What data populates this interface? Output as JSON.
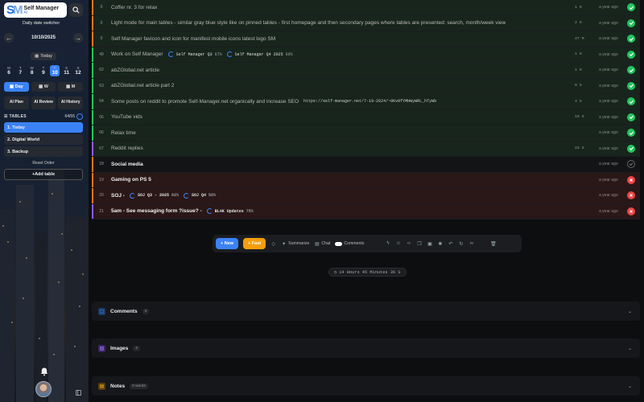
{
  "app": {
    "title": "Self Manager",
    "subtitle": "AI",
    "daily_switcher": "Daily date switcher"
  },
  "date": {
    "current": "10/10/2025",
    "today_label": "Today"
  },
  "days": [
    {
      "wd": "M",
      "n": "6"
    },
    {
      "wd": "T",
      "n": "7"
    },
    {
      "wd": "W",
      "n": "8"
    },
    {
      "wd": "T",
      "n": "9"
    },
    {
      "wd": "F",
      "n": "10"
    },
    {
      "wd": "S",
      "n": "11"
    },
    {
      "wd": "S",
      "n": "12"
    }
  ],
  "modes": [
    "Day",
    "W",
    "M"
  ],
  "ai_buttons": [
    "AI Plan",
    "AI Review",
    "AI History"
  ],
  "tables": {
    "title": "TABLES",
    "count": "64/55",
    "items": [
      "1. Today",
      "2. Digital World",
      "3. Backup"
    ],
    "reset": "Reset Order",
    "add": "+Add table"
  },
  "rows": [
    {
      "num": "0",
      "title": "Coffer nr. 3 for relax",
      "dur": "1 H",
      "when": "a year ago",
      "status": "done",
      "tone": "green",
      "bar": "#f97316"
    },
    {
      "num": "0",
      "title": "Light mode for main tables - similar gray blue style like on pinned tables - first homepage and then secondary pages where tables are presented: search, month/week view",
      "dur": "2 H",
      "when": "a year ago",
      "status": "done",
      "tone": "green",
      "bar": "#f97316"
    },
    {
      "num": "0",
      "title": "Self Manager favicon and icon for manifest mobile icons latest logo SM",
      "dur": "47 M",
      "when": "a year ago",
      "status": "done",
      "tone": "green",
      "bar": "#f97316"
    },
    {
      "num": "49",
      "title": "Work on Self Manager",
      "tags": [
        {
          "name": "Self Manager Q3",
          "pct": "87%"
        },
        {
          "name": "Self Manager Q4 2025",
          "pct": "80%"
        }
      ],
      "dur": "1 H",
      "when": "a year ago",
      "status": "done",
      "tone": "green",
      "bar": "#22c55e"
    },
    {
      "num": "62",
      "title": "abZGlobal.net article",
      "dur": "1 H",
      "when": "a year ago",
      "status": "done",
      "tone": "green",
      "bar": "#22c55e"
    },
    {
      "num": "63",
      "title": "abZGlobal.net article part 2",
      "dur": "6 S",
      "when": "a year ago",
      "status": "done",
      "tone": "green",
      "bar": "#22c55e"
    },
    {
      "num": "64",
      "title": "Some posts on reddit to promote Self-Manager.net organically and increase SEO",
      "url": "https://self-manager.net/7-19-2024/~0Kv0fYMHWyWRL_hTyWb",
      "dur": "4 S",
      "when": "a year ago",
      "status": "done",
      "tone": "green",
      "bar": "#22c55e"
    },
    {
      "num": "66",
      "title": "YouTube vids",
      "dur": "16 S",
      "when": "a year ago",
      "status": "done",
      "tone": "green",
      "bar": "#22c55e"
    },
    {
      "num": "66",
      "title": "Relax time",
      "dur": "",
      "when": "a year ago",
      "status": "done",
      "tone": "green",
      "bar": "#22c55e"
    },
    {
      "num": "67",
      "title": "Reddit replies",
      "dur": "22 S",
      "when": "a year ago",
      "status": "done",
      "tone": "green",
      "bar": "#8b5cf6"
    },
    {
      "num": "18",
      "title": "Social media",
      "dur": "",
      "when": "a year ago",
      "status": "open",
      "tone": "dark",
      "bar": "#f97316",
      "bold": true
    },
    {
      "num": "19",
      "title": "Gaming on PS 5",
      "dur": "",
      "when": "a year ago",
      "status": "fail",
      "tone": "red",
      "bar": "#f97316",
      "bold": true
    },
    {
      "num": "20",
      "title": "SOJ -",
      "tags": [
        {
          "name": "SOJ Q3 - 2025",
          "pct": "82%"
        },
        {
          "name": "SOJ Q4",
          "pct": "50%"
        }
      ],
      "dur": "",
      "when": "a year ago",
      "status": "fail",
      "tone": "red",
      "bar": "#f97316",
      "bold": true
    },
    {
      "num": "21",
      "title": "5am - See messaging form ?issue? -",
      "tags": [
        {
          "name": "BL4K Updates",
          "pct": "75%"
        }
      ],
      "dur": "",
      "when": "a year ago",
      "status": "fail",
      "tone": "red",
      "bar": "#8b5cf6",
      "bold": true
    }
  ],
  "toolbar": {
    "new": "+ New",
    "fast": "+ Fast",
    "summarize": "Summarize",
    "chat": "Chat",
    "comments": "Comments"
  },
  "timer": "14 Hours 45 Minutes 36 S",
  "sections": [
    {
      "title": "Comments",
      "count": "3",
      "icon_color": "#3b82f6"
    },
    {
      "title": "Images",
      "count": "2",
      "icon_color": "#8b5cf6"
    },
    {
      "title": "Notes",
      "count": "0 words",
      "icon_color": "#f59e0b"
    }
  ]
}
